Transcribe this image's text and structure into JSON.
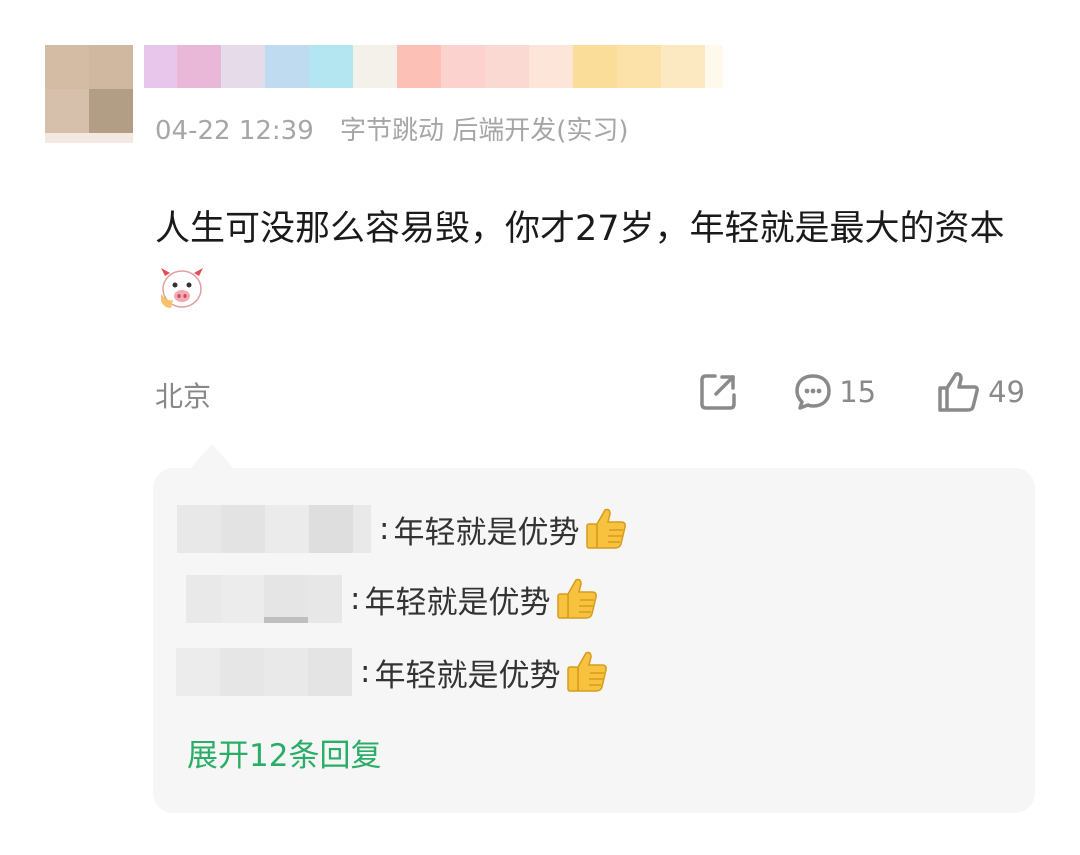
{
  "post": {
    "timestamp": "04-22 12:39",
    "author_info": "字节跳动 后端开发(实习)",
    "content": "人生可没那么容易毁，你才27岁，年轻就是最大的资本",
    "location": "北京",
    "comment_count": "15",
    "like_count": "49",
    "icons": {
      "share": "share-icon",
      "comment": "comment-bubble-icon",
      "like": "thumbs-up-outline-icon",
      "emoji": "cow-emoji-icon"
    }
  },
  "replies": [
    {
      "colon": ":",
      "text": "年轻就是优势",
      "emoji": "thumbs-up-emoji"
    },
    {
      "colon": ":",
      "text": "年轻就是优势",
      "emoji": "thumbs-up-emoji"
    },
    {
      "colon": ":",
      "text": "年轻就是优势",
      "emoji": "thumbs-up-emoji"
    }
  ],
  "expand_label": "展开12条回复",
  "colors": {
    "accent_green": "#2aae67",
    "meta_gray": "#a6a6a6",
    "reply_bg": "#f6f6f6"
  }
}
